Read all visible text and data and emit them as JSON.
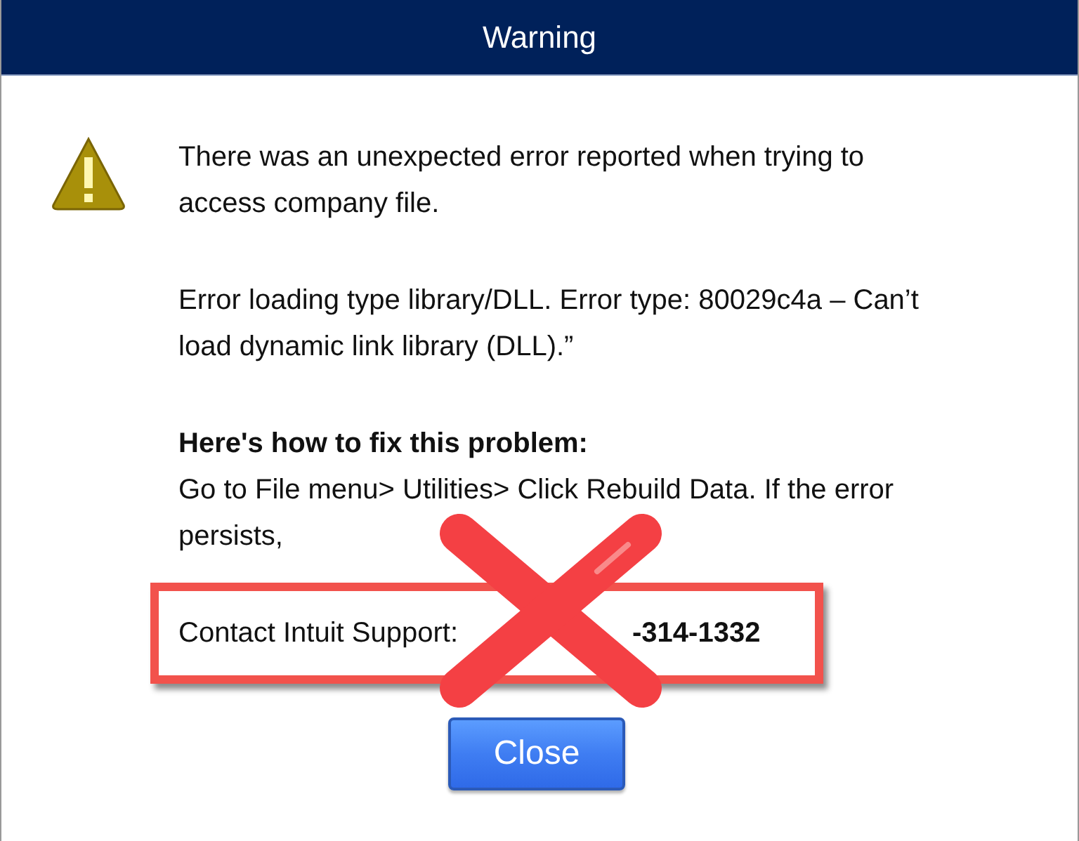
{
  "window": {
    "title": "Warning"
  },
  "message": {
    "paragraphs": [
      "There was an unexpected error reported when trying to access company file.",
      "Error loading type library/DLL. Error type: 80029c4a – Can’t load dynamic link library (DLL).”"
    ],
    "fix_heading": "Here's how to fix this problem:",
    "fix_text": "Go to File menu> Utilities> Click Rebuild Data. If the error persists,",
    "support_label": "Contact Intuit Support:",
    "support_phone": "-314-1332"
  },
  "buttons": [
    {
      "label": "Close"
    }
  ]
}
